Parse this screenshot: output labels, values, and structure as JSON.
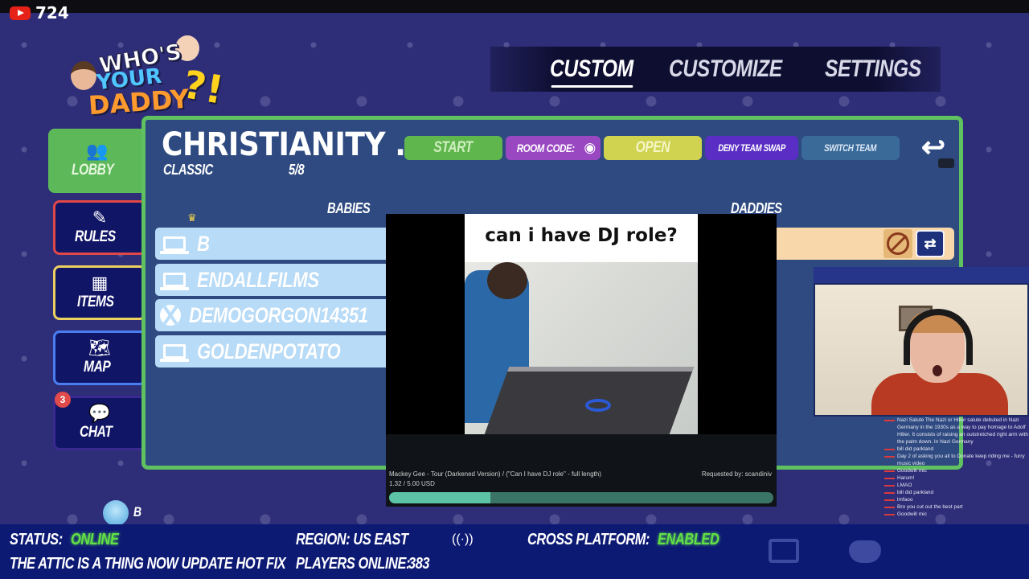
{
  "stream": {
    "viewer_count": "724",
    "platform_icon": "youtube-icon"
  },
  "logo": {
    "line1": "WHO'S",
    "line2": "YOUR",
    "line3": "DADDY",
    "mark": "?!"
  },
  "nav": {
    "tabs": [
      {
        "label": "CUSTOM",
        "active": true
      },
      {
        "label": "CUSTOMIZE",
        "active": false
      },
      {
        "label": "SETTINGS",
        "active": false
      }
    ]
  },
  "sidebar": {
    "items": [
      {
        "label": "LOBBY",
        "icon": "users-icon",
        "active": true
      },
      {
        "label": "RULES",
        "icon": "pencil-icon"
      },
      {
        "label": "ITEMS",
        "icon": "grid-icon"
      },
      {
        "label": "MAP",
        "icon": "map-icon"
      },
      {
        "label": "CHAT",
        "icon": "chat-bubble-icon",
        "badge": "3"
      }
    ]
  },
  "lobby": {
    "title": "CHRISTIANITY ...",
    "mode": "CLASSIC",
    "player_count": "5/8",
    "buttons": {
      "start": "START",
      "room_code": "ROOM CODE:",
      "open": "OPEN",
      "deny_team_swap": "DENY TEAM SWAP",
      "switch_team": "SWITCH TEAM"
    },
    "colors": {
      "start": "#5fb64c",
      "room_code": "#9a48c2",
      "open": "#cfd350",
      "deny": "#5a2ec4",
      "switch": "#3a6a98",
      "panel_border": "#5fc160"
    },
    "babies_header": "BABIES",
    "daddies_header": "DADDIES",
    "babies": [
      {
        "name": "B",
        "platform": "pc",
        "host": true
      },
      {
        "name": "ENDALLFILMS",
        "platform": "pc"
      },
      {
        "name": "DEMOGORGON14351",
        "platform": "xbox"
      },
      {
        "name": "GOLDENPOTATO",
        "platform": "pc"
      }
    ]
  },
  "media": {
    "caption": "can i have DJ role?",
    "song": "Mackey Gee - Tour (Darkened Version) / (\"Can I have DJ role\" - full length)",
    "requested_by": "Requested by: scandiniv",
    "amount": "1.32 / 5.00 USD",
    "progress_fraction": 0.264
  },
  "chat_overlay": [
    "Nazi Salute The Nazi or Hitler salute debuted in Nazi Germany in the 1930s as a way to pay homage to Adolf Hitler. It consists of raising an outstretched right arm with the palm down. In Nazi Germany",
    "bill did parkland",
    "Day 2 of asking you all to Donate keep riding me - furry music video",
    "Goodwill mic",
    "Harum!",
    "LMAO",
    "bill did parkland",
    "lmfaoo",
    "Bro you cut out the best part",
    "Goodwill mic"
  ],
  "player": {
    "name": "B"
  },
  "status_bar": {
    "status_label": "STATUS:",
    "status_value": "ONLINE",
    "patch_note": "THE ATTIC IS A THING NOW UPDATE HOT FIX",
    "region": "REGION: US EAST",
    "players_online_label": "PLAYERS ONLINE:",
    "players_online_value": "383",
    "cross_platform_label": "CROSS PLATFORM:",
    "cross_platform_value": "ENABLED",
    "signal_icon": "((·))"
  }
}
